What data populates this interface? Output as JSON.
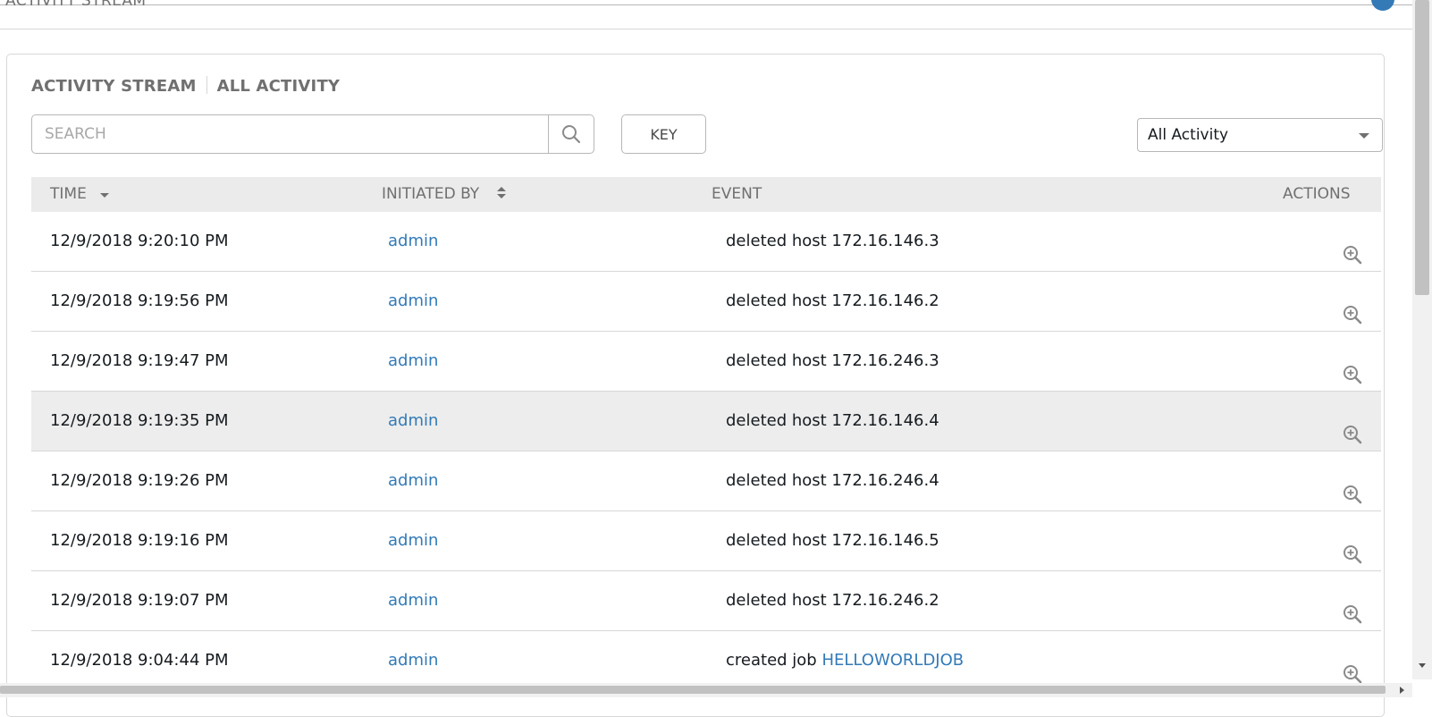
{
  "header": {
    "title": "ACTIVITY STREAM"
  },
  "panel": {
    "title": "ACTIVITY STREAM",
    "subtitle": "ALL ACTIVITY"
  },
  "search": {
    "placeholder": "SEARCH",
    "value": "",
    "icon": "search-icon"
  },
  "key_button": {
    "label": "KEY"
  },
  "filter": {
    "selected": "All Activity"
  },
  "table": {
    "columns": {
      "time": "TIME",
      "initiated_by": "INITIATED BY",
      "event": "EVENT",
      "actions": "ACTIONS"
    },
    "rows": [
      {
        "time": "12/9/2018 9:20:10 PM",
        "user": "admin",
        "event": "deleted host 172.16.146.3",
        "object": ""
      },
      {
        "time": "12/9/2018 9:19:56 PM",
        "user": "admin",
        "event": "deleted host 172.16.146.2",
        "object": ""
      },
      {
        "time": "12/9/2018 9:19:47 PM",
        "user": "admin",
        "event": "deleted host 172.16.246.3",
        "object": ""
      },
      {
        "time": "12/9/2018 9:19:35 PM",
        "user": "admin",
        "event": "deleted host 172.16.146.4",
        "object": ""
      },
      {
        "time": "12/9/2018 9:19:26 PM",
        "user": "admin",
        "event": "deleted host 172.16.246.4",
        "object": ""
      },
      {
        "time": "12/9/2018 9:19:16 PM",
        "user": "admin",
        "event": "deleted host 172.16.146.5",
        "object": ""
      },
      {
        "time": "12/9/2018 9:19:07 PM",
        "user": "admin",
        "event": "deleted host 172.16.246.2",
        "object": ""
      },
      {
        "time": "12/9/2018 9:04:44 PM",
        "user": "admin",
        "event": "created job ",
        "object": "HELLOWORLDJOB"
      }
    ],
    "highlighted_row": 3
  },
  "colors": {
    "link": "#337ab7",
    "muted": "#707070",
    "border": "#d7d7d7",
    "header_bg": "#ebebeb"
  }
}
